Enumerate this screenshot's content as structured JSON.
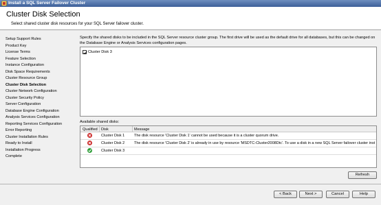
{
  "window": {
    "title": "Install a SQL Server Failover Cluster",
    "app_icon": "sql-server-setup-icon"
  },
  "header": {
    "title": "Cluster Disk Selection",
    "subtitle": "Select shared cluster disk resources for your SQL Server failover cluster."
  },
  "sidebar": {
    "items": [
      {
        "label": "Setup Support Rules",
        "active": false
      },
      {
        "label": "Product Key",
        "active": false
      },
      {
        "label": "License Terms",
        "active": false
      },
      {
        "label": "Feature Selection",
        "active": false
      },
      {
        "label": "Instance Configuration",
        "active": false
      },
      {
        "label": "Disk Space Requirements",
        "active": false
      },
      {
        "label": "Cluster Resource Group",
        "active": false
      },
      {
        "label": "Cluster Disk Selection",
        "active": true
      },
      {
        "label": "Cluster Network Configuration",
        "active": false
      },
      {
        "label": "Cluster Security Policy",
        "active": false
      },
      {
        "label": "Server Configuration",
        "active": false
      },
      {
        "label": "Database Engine Configuration",
        "active": false
      },
      {
        "label": "Analysis Services Configuration",
        "active": false
      },
      {
        "label": "Reporting Services Configuration",
        "active": false
      },
      {
        "label": "Error Reporting",
        "active": false
      },
      {
        "label": "Cluster Installation Rules",
        "active": false
      },
      {
        "label": "Ready to Install",
        "active": false
      },
      {
        "label": "Installation Progress",
        "active": false
      },
      {
        "label": "Complete",
        "active": false
      }
    ]
  },
  "main": {
    "description": "Specify the shared disks to be included in the SQL Server resource cluster group. The first drive will be used as the default drive for all databases, but this can be changed on the Database Engine or Analysis Services configuration pages.",
    "selected_disks": [
      {
        "label": "Cluster Disk 3",
        "checked": true
      }
    ],
    "available_label": "Available shared disks:",
    "table": {
      "columns": [
        "Qualified",
        "Disk",
        "Message"
      ],
      "rows": [
        {
          "status": "error",
          "status_icon": "error-icon",
          "disk": "Cluster Disk 1",
          "message": "The disk resource 'Cluster Disk 1' cannot be used because it is a cluster quorum drive."
        },
        {
          "status": "error",
          "status_icon": "error-icon",
          "disk": "Cluster Disk 2",
          "message": "The disk resource 'Cluster Disk 2' is already in use by resource 'MSDTC-Cluster2008Dtc'. To use a disk in a new SQL Server failover cluster instance..."
        },
        {
          "status": "ok",
          "status_icon": "check-icon",
          "disk": "Cluster Disk 3",
          "message": ""
        }
      ]
    },
    "refresh_label": "Refresh"
  },
  "footer": {
    "back_label": "< Back",
    "next_label": "Next >",
    "cancel_label": "Cancel",
    "help_label": "Help"
  },
  "colors": {
    "error": "#cc2b2b",
    "ok": "#2e9e38",
    "selected_row": "#3399ff",
    "titlebar": "#3d5f99"
  }
}
